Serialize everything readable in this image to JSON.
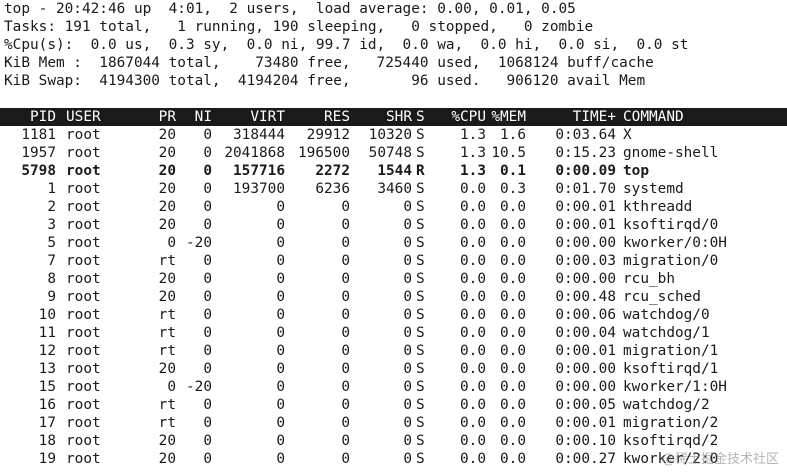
{
  "summary": {
    "uptime_line": "top - 20:42:46 up  4:01,  2 users,  load average: 0.00, 0.01, 0.05",
    "tasks_line": "Tasks: 191 total,   1 running, 190 sleeping,   0 stopped,   0 zombie",
    "cpu_line": "%Cpu(s):  0.0 us,  0.3 sy,  0.0 ni, 99.7 id,  0.0 wa,  0.0 hi,  0.0 si,  0.0 st",
    "mem_line": "KiB Mem :  1867044 total,    73480 free,   725440 used,  1068124 buff/cache",
    "swap_line": "KiB Swap:  4194300 total,  4194204 free,       96 used.   906120 avail Mem"
  },
  "columns": {
    "pid": "PID",
    "user": "USER",
    "pr": "PR",
    "ni": "NI",
    "virt": "VIRT",
    "res": "RES",
    "shr": "SHR",
    "s": "S",
    "cpu": "%CPU",
    "mem": "%MEM",
    "time": "TIME+",
    "command": "COMMAND"
  },
  "processes": [
    {
      "pid": "1181",
      "user": "root",
      "pr": "20",
      "ni": "0",
      "virt": "318444",
      "res": "29912",
      "shr": "10320",
      "s": "S",
      "cpu": "1.3",
      "mem": "1.6",
      "time": "0:03.64",
      "command": "X",
      "bold": false
    },
    {
      "pid": "1957",
      "user": "root",
      "pr": "20",
      "ni": "0",
      "virt": "2041868",
      "res": "196500",
      "shr": "50748",
      "s": "S",
      "cpu": "1.3",
      "mem": "10.5",
      "time": "0:15.23",
      "command": "gnome-shell",
      "bold": false
    },
    {
      "pid": "5798",
      "user": "root",
      "pr": "20",
      "ni": "0",
      "virt": "157716",
      "res": "2272",
      "shr": "1544",
      "s": "R",
      "cpu": "1.3",
      "mem": "0.1",
      "time": "0:00.09",
      "command": "top",
      "bold": true
    },
    {
      "pid": "1",
      "user": "root",
      "pr": "20",
      "ni": "0",
      "virt": "193700",
      "res": "6236",
      "shr": "3460",
      "s": "S",
      "cpu": "0.0",
      "mem": "0.3",
      "time": "0:01.70",
      "command": "systemd",
      "bold": false
    },
    {
      "pid": "2",
      "user": "root",
      "pr": "20",
      "ni": "0",
      "virt": "0",
      "res": "0",
      "shr": "0",
      "s": "S",
      "cpu": "0.0",
      "mem": "0.0",
      "time": "0:00.01",
      "command": "kthreadd",
      "bold": false
    },
    {
      "pid": "3",
      "user": "root",
      "pr": "20",
      "ni": "0",
      "virt": "0",
      "res": "0",
      "shr": "0",
      "s": "S",
      "cpu": "0.0",
      "mem": "0.0",
      "time": "0:00.01",
      "command": "ksoftirqd/0",
      "bold": false
    },
    {
      "pid": "5",
      "user": "root",
      "pr": "0",
      "ni": "-20",
      "virt": "0",
      "res": "0",
      "shr": "0",
      "s": "S",
      "cpu": "0.0",
      "mem": "0.0",
      "time": "0:00.00",
      "command": "kworker/0:0H",
      "bold": false
    },
    {
      "pid": "7",
      "user": "root",
      "pr": "rt",
      "ni": "0",
      "virt": "0",
      "res": "0",
      "shr": "0",
      "s": "S",
      "cpu": "0.0",
      "mem": "0.0",
      "time": "0:00.03",
      "command": "migration/0",
      "bold": false
    },
    {
      "pid": "8",
      "user": "root",
      "pr": "20",
      "ni": "0",
      "virt": "0",
      "res": "0",
      "shr": "0",
      "s": "S",
      "cpu": "0.0",
      "mem": "0.0",
      "time": "0:00.00",
      "command": "rcu_bh",
      "bold": false
    },
    {
      "pid": "9",
      "user": "root",
      "pr": "20",
      "ni": "0",
      "virt": "0",
      "res": "0",
      "shr": "0",
      "s": "S",
      "cpu": "0.0",
      "mem": "0.0",
      "time": "0:00.48",
      "command": "rcu_sched",
      "bold": false
    },
    {
      "pid": "10",
      "user": "root",
      "pr": "rt",
      "ni": "0",
      "virt": "0",
      "res": "0",
      "shr": "0",
      "s": "S",
      "cpu": "0.0",
      "mem": "0.0",
      "time": "0:00.06",
      "command": "watchdog/0",
      "bold": false
    },
    {
      "pid": "11",
      "user": "root",
      "pr": "rt",
      "ni": "0",
      "virt": "0",
      "res": "0",
      "shr": "0",
      "s": "S",
      "cpu": "0.0",
      "mem": "0.0",
      "time": "0:00.04",
      "command": "watchdog/1",
      "bold": false
    },
    {
      "pid": "12",
      "user": "root",
      "pr": "rt",
      "ni": "0",
      "virt": "0",
      "res": "0",
      "shr": "0",
      "s": "S",
      "cpu": "0.0",
      "mem": "0.0",
      "time": "0:00.01",
      "command": "migration/1",
      "bold": false
    },
    {
      "pid": "13",
      "user": "root",
      "pr": "20",
      "ni": "0",
      "virt": "0",
      "res": "0",
      "shr": "0",
      "s": "S",
      "cpu": "0.0",
      "mem": "0.0",
      "time": "0:00.00",
      "command": "ksoftirqd/1",
      "bold": false
    },
    {
      "pid": "15",
      "user": "root",
      "pr": "0",
      "ni": "-20",
      "virt": "0",
      "res": "0",
      "shr": "0",
      "s": "S",
      "cpu": "0.0",
      "mem": "0.0",
      "time": "0:00.00",
      "command": "kworker/1:0H",
      "bold": false
    },
    {
      "pid": "16",
      "user": "root",
      "pr": "rt",
      "ni": "0",
      "virt": "0",
      "res": "0",
      "shr": "0",
      "s": "S",
      "cpu": "0.0",
      "mem": "0.0",
      "time": "0:00.05",
      "command": "watchdog/2",
      "bold": false
    },
    {
      "pid": "17",
      "user": "root",
      "pr": "rt",
      "ni": "0",
      "virt": "0",
      "res": "0",
      "shr": "0",
      "s": "S",
      "cpu": "0.0",
      "mem": "0.0",
      "time": "0:00.01",
      "command": "migration/2",
      "bold": false
    },
    {
      "pid": "18",
      "user": "root",
      "pr": "20",
      "ni": "0",
      "virt": "0",
      "res": "0",
      "shr": "0",
      "s": "S",
      "cpu": "0.0",
      "mem": "0.0",
      "time": "0:00.10",
      "command": "ksoftirqd/2",
      "bold": false
    },
    {
      "pid": "19",
      "user": "root",
      "pr": "20",
      "ni": "0",
      "virt": "0",
      "res": "0",
      "shr": "0",
      "s": "S",
      "cpu": "0.0",
      "mem": "0.0",
      "time": "0:00.27",
      "command": "kworker/2:0",
      "bold": false
    }
  ],
  "watermark": "@稀土掘金技术社区",
  "colors": {
    "background": "#ffffff",
    "text": "#1a1a1a",
    "header_bar": "#1a1a1a",
    "header_text": "#ffffff"
  }
}
